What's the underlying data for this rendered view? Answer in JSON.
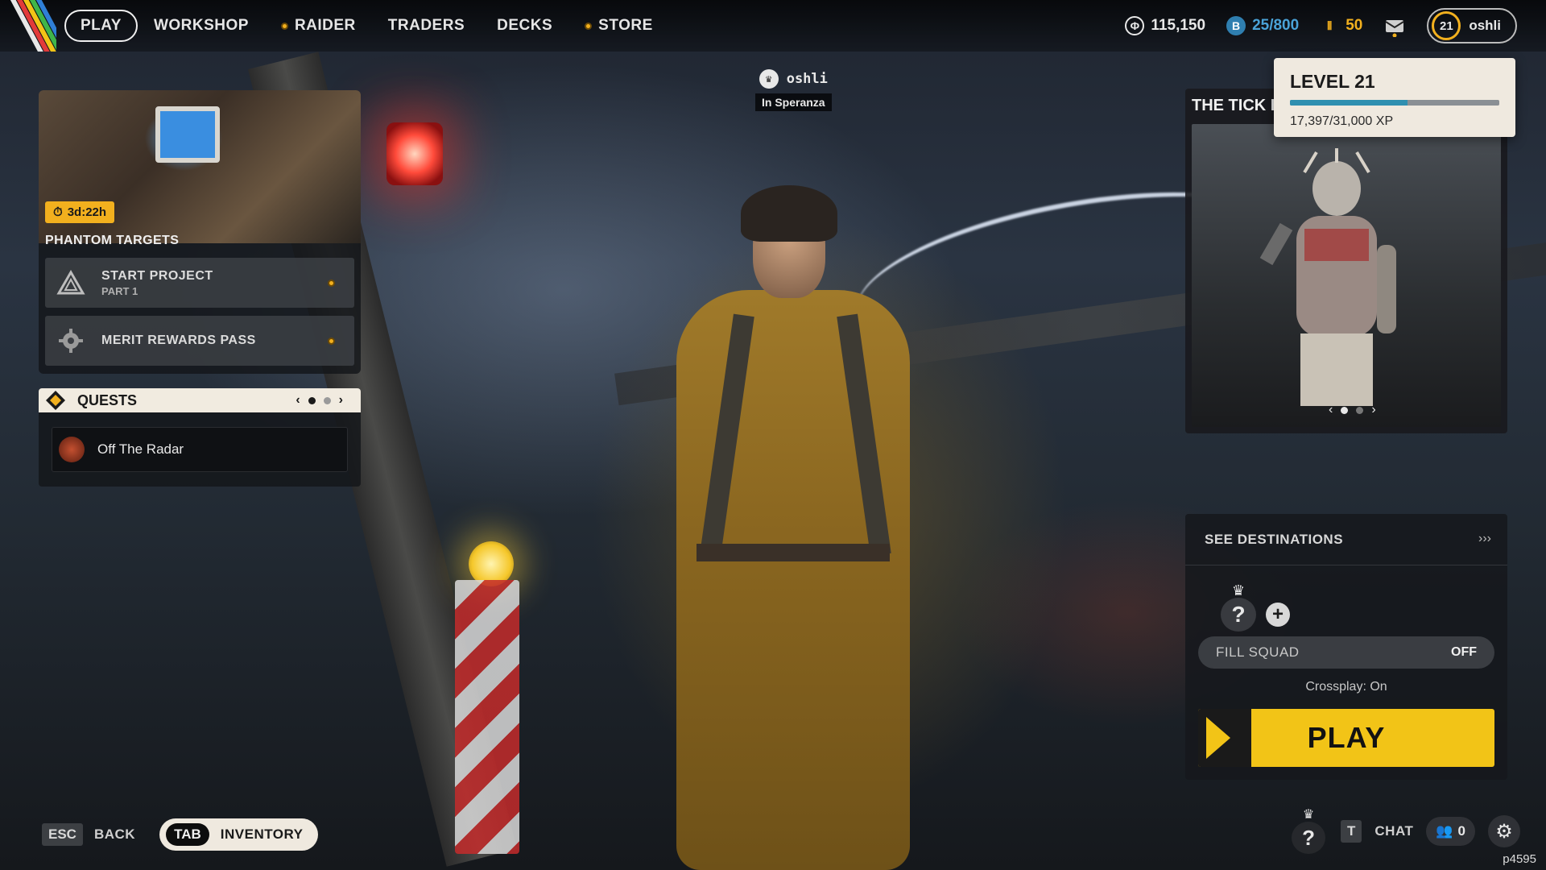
{
  "nav": {
    "items": [
      {
        "label": "PLAY",
        "active": true,
        "badge": false
      },
      {
        "label": "WORKSHOP",
        "active": false,
        "badge": false
      },
      {
        "label": "RAIDER",
        "active": false,
        "badge": true
      },
      {
        "label": "TRADERS",
        "active": false,
        "badge": false
      },
      {
        "label": "DECKS",
        "active": false,
        "badge": false
      },
      {
        "label": "STORE",
        "active": false,
        "badge": true
      }
    ]
  },
  "currencies": {
    "coins": "115,150",
    "tokens": "25/800",
    "raider_tokens": "50"
  },
  "profile": {
    "level": "21",
    "username": "oshli"
  },
  "level_popup": {
    "title": "LEVEL 21",
    "xp_text": "17,397/31,000 XP",
    "xp_progress": 0.561
  },
  "phantom": {
    "timer": "3d:22h",
    "title": "PHANTOM TARGETS",
    "rows": [
      {
        "label": "START PROJECT",
        "sub": "PART 1",
        "icon": "warning-triangle-icon"
      },
      {
        "label": "MERIT REWARDS PASS",
        "sub": "",
        "icon": "gear-badge-icon"
      }
    ]
  },
  "quests": {
    "title": "QUESTS",
    "item": "Off The Radar"
  },
  "player_tag": {
    "name": "oshli",
    "location": "In Speranza"
  },
  "tick": {
    "title": "THE TICK H"
  },
  "squad": {
    "destinations": "SEE DESTINATIONS",
    "fill_label": "FILL SQUAD",
    "fill_value": "OFF",
    "crossplay": "Crossplay: On",
    "play": "PLAY"
  },
  "bottom": {
    "esc_key": "ESC",
    "back": "BACK",
    "tab_key": "TAB",
    "inventory": "INVENTORY",
    "chat_key": "T",
    "chat": "CHAT",
    "friends_count": "0",
    "build": "p4595"
  },
  "colors": {
    "accent": "#f2c417",
    "badge": "#f2b01e",
    "xp": "#2f8fb0"
  }
}
